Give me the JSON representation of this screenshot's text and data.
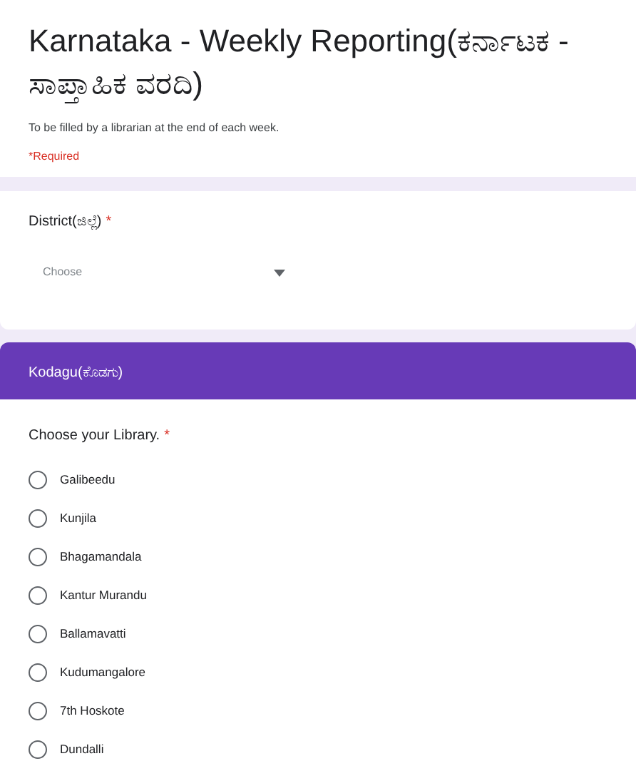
{
  "form": {
    "title": "Karnataka - Weekly Reporting(ಕರ್ನಾಟಕ - ಸಾಪ್ತಾಹಿಕ ವರದಿ)",
    "description": "To be filled by a librarian at the end of each week.",
    "required_note": "*Required"
  },
  "district_question": {
    "label": "District(ಜಿಲ್ಲೆ)",
    "required_mark": "*",
    "dropdown": {
      "placeholder": "Choose"
    }
  },
  "section_header": {
    "title": "Kodagu(ಕೊಡಗು)"
  },
  "library_question": {
    "label": "Choose your Library.",
    "required_mark": "*",
    "options": [
      {
        "label": "Galibeedu",
        "selected": false
      },
      {
        "label": "Kunjila",
        "selected": false
      },
      {
        "label": "Bhagamandala",
        "selected": false
      },
      {
        "label": "Kantur Murandu",
        "selected": false
      },
      {
        "label": "Ballamavatti",
        "selected": false
      },
      {
        "label": "Kudumangalore",
        "selected": false
      },
      {
        "label": "7th Hoskote",
        "selected": false
      },
      {
        "label": "Dundalli",
        "selected": false
      }
    ]
  }
}
